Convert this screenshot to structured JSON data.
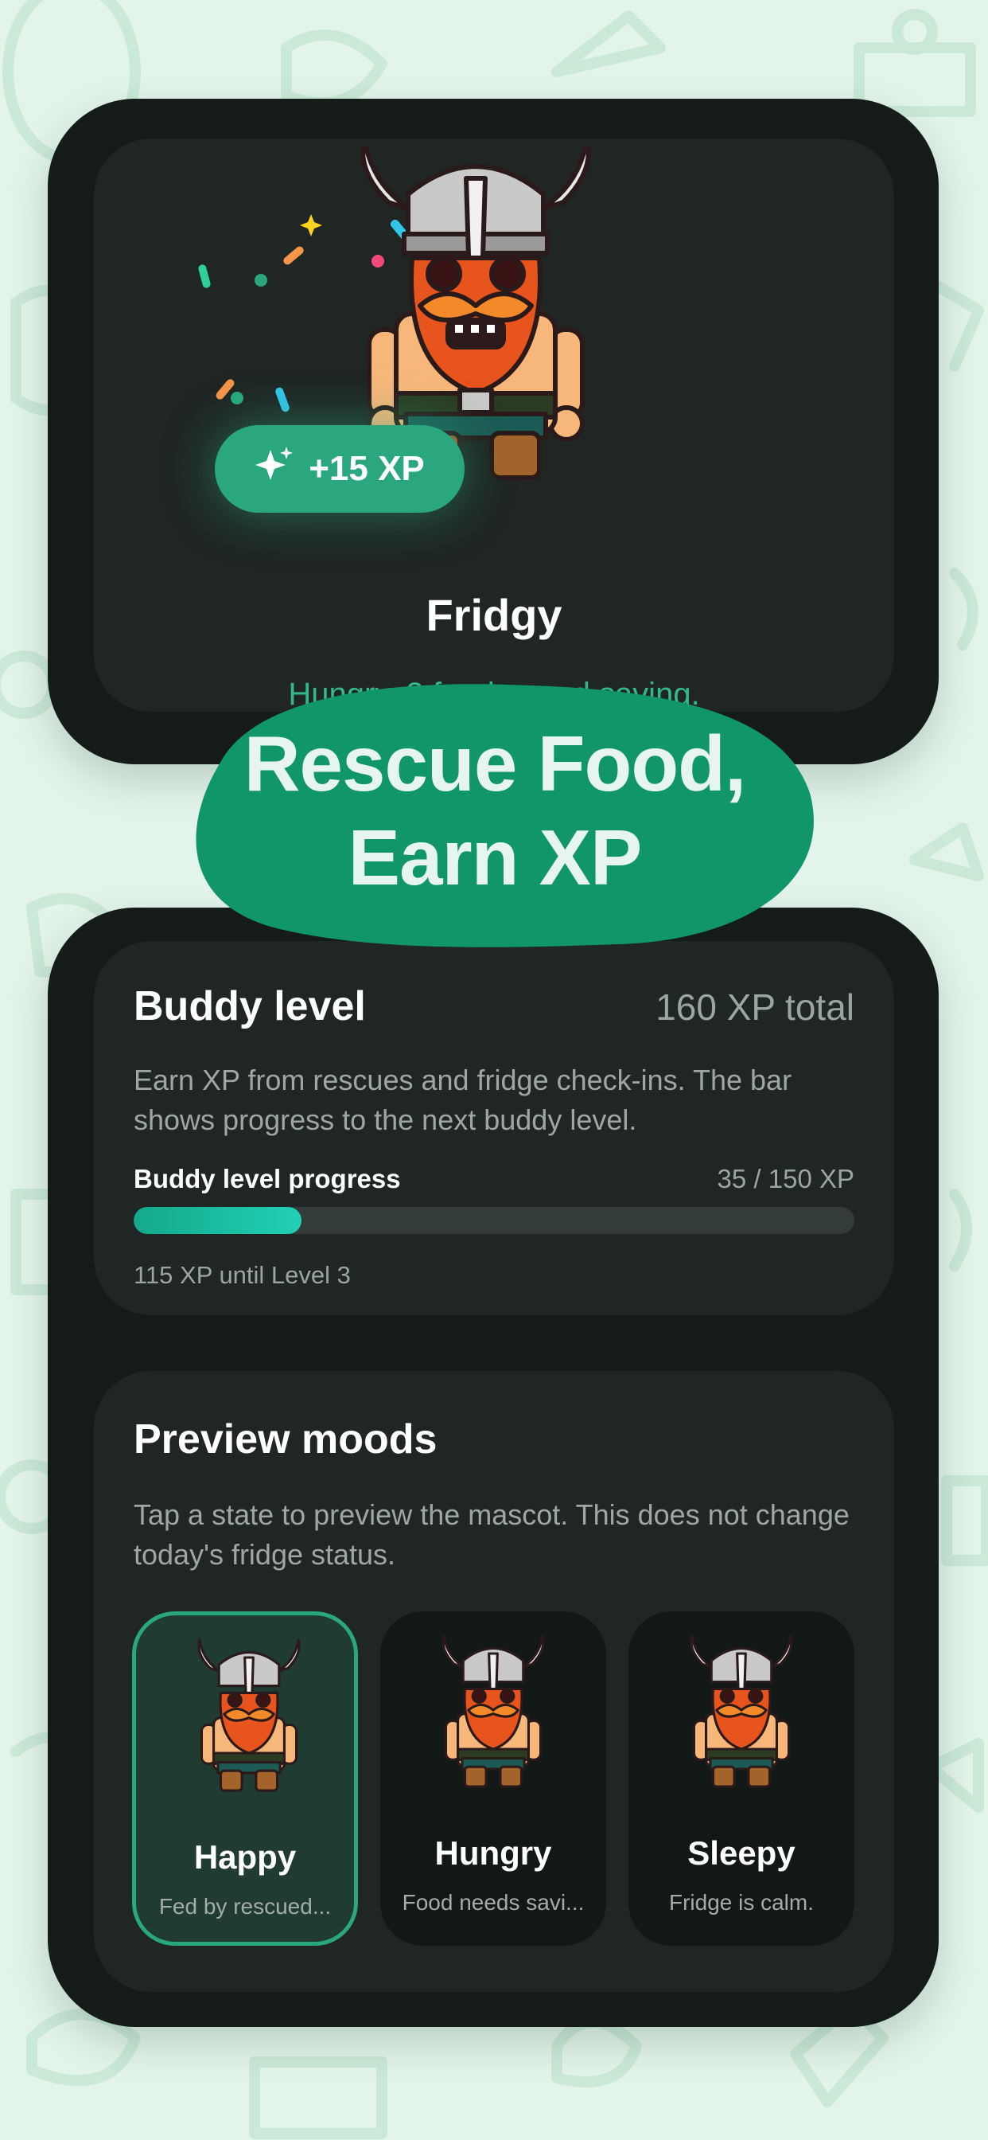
{
  "colors": {
    "background": "#e3f4ea",
    "phone": "#141b18",
    "card": "#1f2623",
    "accent": "#2aa77f",
    "status_text": "#33b88a",
    "progress_fill": "#22d0b6"
  },
  "hero": {
    "mascot_name": "Fridgy",
    "mascot_icon": "viking-mascot-icon",
    "status": "Hungry. 3 foods need saving.",
    "xp_badge": {
      "icon": "sparkle-icon",
      "label": "+15 XP"
    }
  },
  "headline": {
    "line1": "Rescue Food,",
    "line2": "Earn XP"
  },
  "buddy_level": {
    "title": "Buddy level",
    "total": "160 XP total",
    "description": "Earn XP from rescues and fridge check-ins. The bar shows progress to the next buddy level.",
    "progress_label": "Buddy level progress",
    "progress_value": "35 / 150 XP",
    "progress_fraction": 0.2333,
    "hint": "115 XP until Level 3"
  },
  "moods": {
    "title": "Preview moods",
    "description": "Tap a state to preview the mascot. This does not change today's fridge status.",
    "items": [
      {
        "name": "Happy",
        "subtitle": "Fed by rescued...",
        "selected": true
      },
      {
        "name": "Hungry",
        "subtitle": "Food needs savi...",
        "selected": false
      },
      {
        "name": "Sleepy",
        "subtitle": "Fridge is calm.",
        "selected": false
      }
    ]
  }
}
